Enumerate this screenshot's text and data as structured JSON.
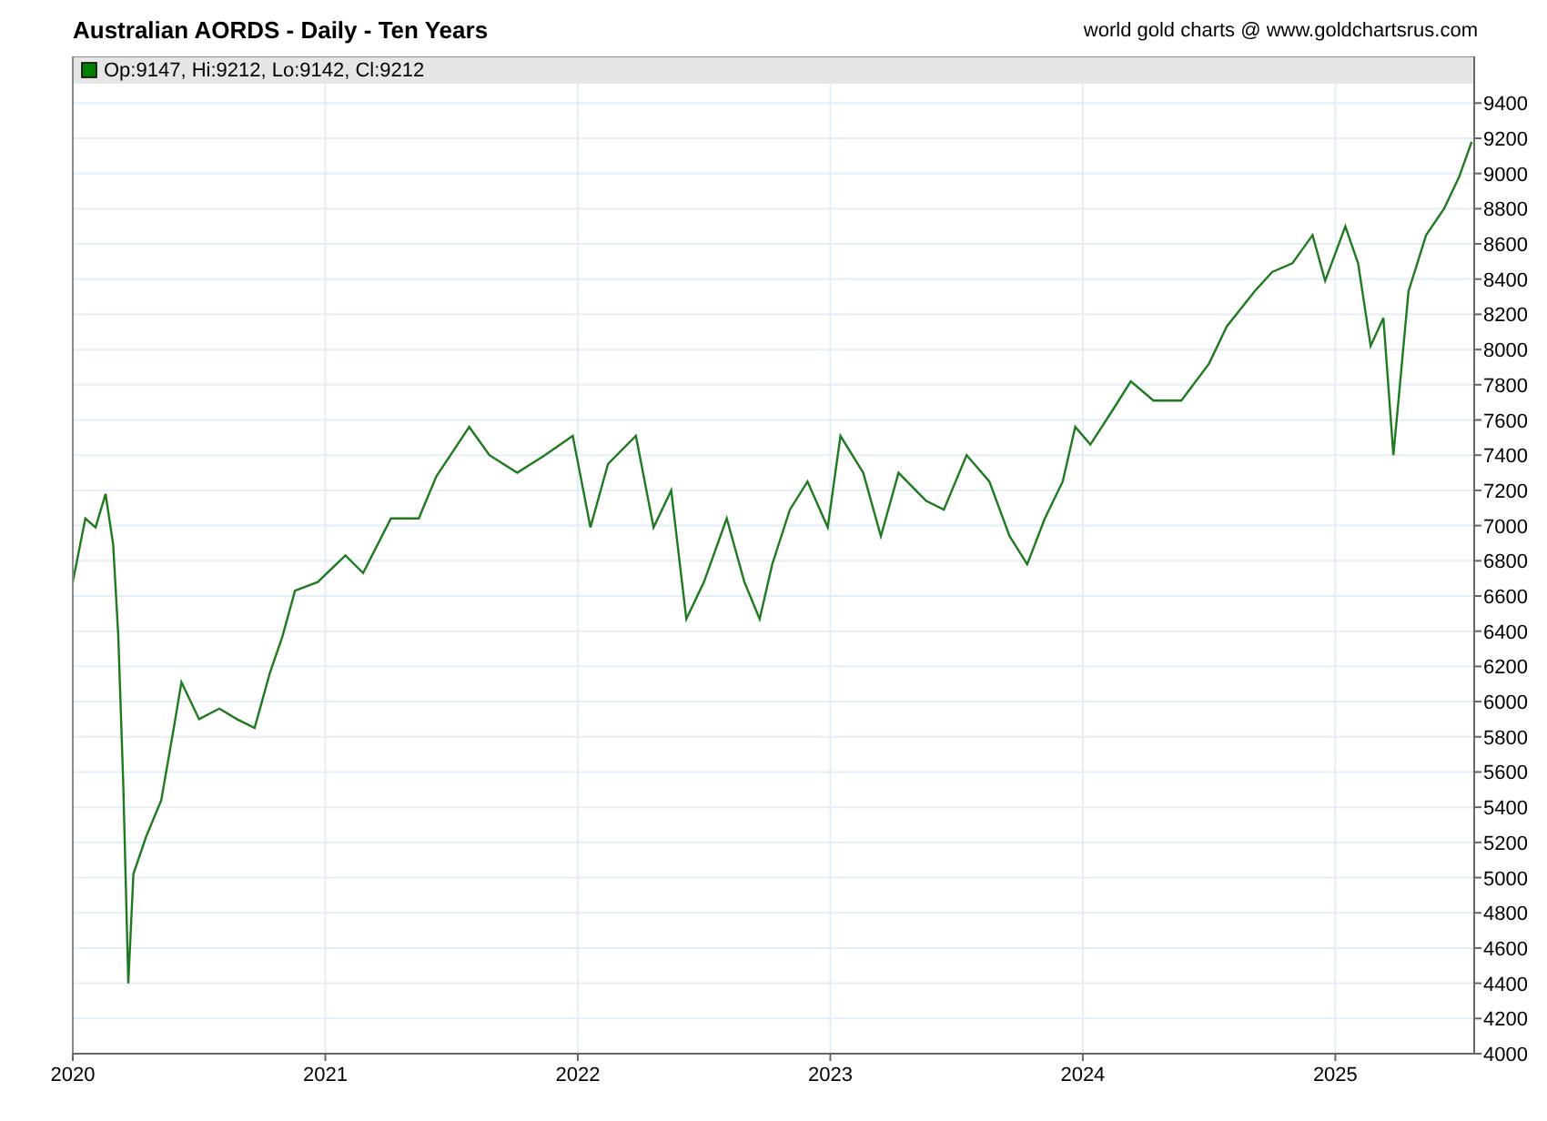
{
  "header": {
    "title": "Australian AORDS - Daily - Ten Years",
    "credit": "world gold charts @ www.goldchartsrus.com"
  },
  "chart": {
    "legend": {
      "text": "Op:9147, Hi:9212, Lo:9142, Cl:9212",
      "color": "#008000"
    },
    "chart_data": {
      "type": "line",
      "grid": true,
      "xlim": [
        2020,
        2025.55
      ],
      "ylim": [
        4000,
        9510
      ],
      "xticks": [
        2020,
        2021,
        2022,
        2023,
        2024,
        2025
      ],
      "yticks": [
        4000,
        4200,
        4400,
        4600,
        4800,
        5000,
        5200,
        5400,
        5600,
        5800,
        6000,
        6200,
        6400,
        6600,
        6800,
        7000,
        7200,
        7400,
        7600,
        7800,
        8000,
        8200,
        8400,
        8600,
        8800,
        9000,
        9200,
        9400
      ],
      "x": [
        2020.0,
        2020.05,
        2020.09,
        2020.13,
        2020.16,
        2020.18,
        2020.2,
        2020.22,
        2020.24,
        2020.29,
        2020.35,
        2020.4,
        2020.43,
        2020.5,
        2020.58,
        2020.65,
        2020.72,
        2020.78,
        2020.83,
        2020.88,
        2020.97,
        2021.08,
        2021.15,
        2021.26,
        2021.37,
        2021.44,
        2021.57,
        2021.65,
        2021.76,
        2021.87,
        2021.98,
        2022.05,
        2022.12,
        2022.23,
        2022.3,
        2022.37,
        2022.43,
        2022.5,
        2022.59,
        2022.66,
        2022.72,
        2022.77,
        2022.84,
        2022.91,
        2022.99,
        2023.04,
        2023.13,
        2023.2,
        2023.27,
        2023.38,
        2023.45,
        2023.54,
        2023.63,
        2023.71,
        2023.78,
        2023.85,
        2023.92,
        2023.97,
        2024.03,
        2024.12,
        2024.19,
        2024.28,
        2024.39,
        2024.5,
        2024.57,
        2024.68,
        2024.75,
        2024.83,
        2024.91,
        2024.96,
        2025.04,
        2025.09,
        2025.14,
        2025.19,
        2025.23,
        2025.25,
        2025.29,
        2025.36,
        2025.43,
        2025.49,
        2025.54
      ],
      "series": [
        {
          "color": "#1f7a1f",
          "values": [
            6680,
            7040,
            6990,
            7180,
            6890,
            6370,
            5540,
            4400,
            5020,
            5230,
            5440,
            5850,
            6110,
            5900,
            5960,
            5900,
            5850,
            6160,
            6370,
            6630,
            6680,
            6830,
            6730,
            7040,
            7040,
            7280,
            7560,
            7400,
            7300,
            7400,
            7510,
            6990,
            7350,
            7510,
            6990,
            7200,
            6470,
            6680,
            7040,
            6680,
            6470,
            6780,
            7090,
            7250,
            6990,
            7510,
            7300,
            6940,
            7300,
            7140,
            7090,
            7400,
            7250,
            6940,
            6780,
            7040,
            7250,
            7560,
            7460,
            7660,
            7820,
            7710,
            7710,
            7920,
            8130,
            8330,
            8440,
            8490,
            8650,
            8390,
            8700,
            8490,
            8020,
            8180,
            7400,
            7710,
            8330,
            8650,
            8800,
            8980,
            9180
          ]
        }
      ]
    }
  }
}
